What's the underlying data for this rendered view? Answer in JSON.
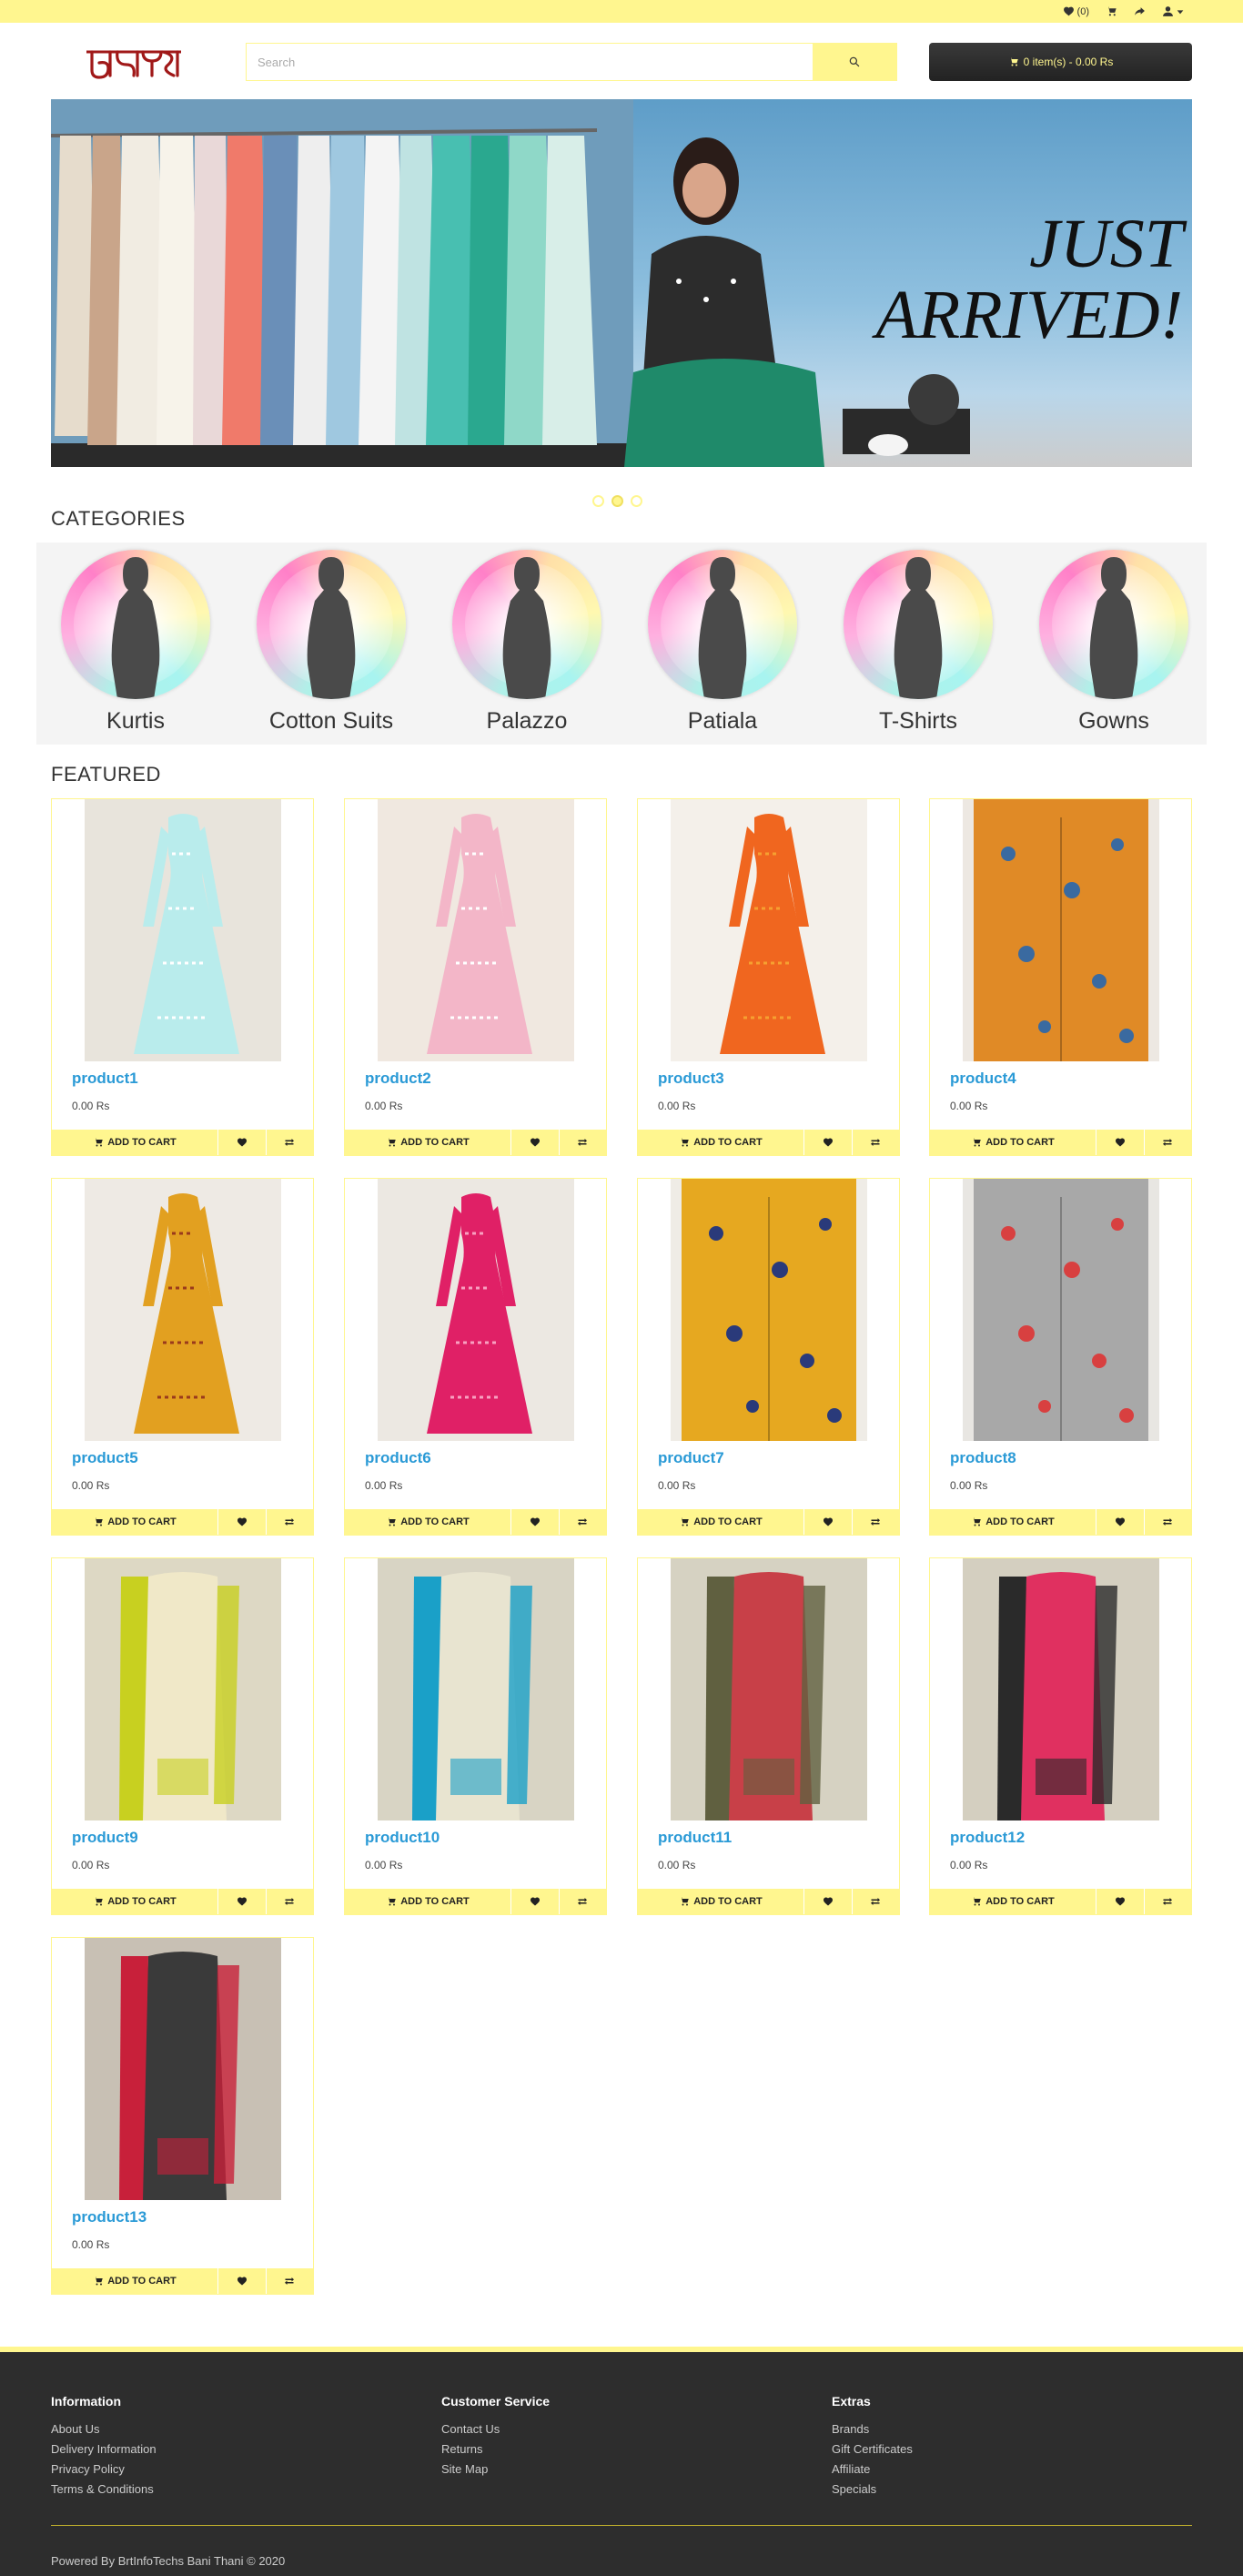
{
  "topbar": {
    "wishlist_count": "(0)"
  },
  "header": {
    "search_placeholder": "Search",
    "cart_summary": "0 item(s) - 0.00 Rs"
  },
  "banner": {
    "line1": "JUST",
    "line2": "ARRIVED!",
    "slide_count": 3,
    "active_slide": 1
  },
  "categories": {
    "title": "CATEGORIES",
    "items": [
      "Kurtis",
      "Cotton Suits",
      "Palazzo",
      "Patiala",
      "T-Shirts",
      "Gowns"
    ]
  },
  "featured": {
    "title": "FEATURED",
    "add_to_cart": "ADD TO CART",
    "products": [
      {
        "name": "product1",
        "price": "0.00 Rs"
      },
      {
        "name": "product2",
        "price": "0.00 Rs"
      },
      {
        "name": "product3",
        "price": "0.00 Rs"
      },
      {
        "name": "product4",
        "price": "0.00 Rs"
      },
      {
        "name": "product5",
        "price": "0.00 Rs"
      },
      {
        "name": "product6",
        "price": "0.00 Rs"
      },
      {
        "name": "product7",
        "price": "0.00 Rs"
      },
      {
        "name": "product8",
        "price": "0.00 Rs"
      },
      {
        "name": "product9",
        "price": "0.00 Rs"
      },
      {
        "name": "product10",
        "price": "0.00 Rs"
      },
      {
        "name": "product11",
        "price": "0.00 Rs"
      },
      {
        "name": "product12",
        "price": "0.00 Rs"
      },
      {
        "name": "product13",
        "price": "0.00 Rs"
      }
    ]
  },
  "footer": {
    "information": {
      "title": "Information",
      "links": [
        "About Us",
        "Delivery Information",
        "Privacy Policy",
        "Terms & Conditions"
      ]
    },
    "customer_service": {
      "title": "Customer Service",
      "links": [
        "Contact Us",
        "Returns",
        "Site Map"
      ]
    },
    "extras": {
      "title": "Extras",
      "links": [
        "Brands",
        "Gift Certificates",
        "Affiliate",
        "Specials"
      ]
    },
    "powered_prefix": "Powered By",
    "powered_link": "BrtInfoTechs",
    "powered_suffix": "Bani Thani © 2020"
  },
  "colors": {
    "accent": "#fff68f",
    "link": "#2a9ad6",
    "footer_bg": "#2d2d2d"
  }
}
